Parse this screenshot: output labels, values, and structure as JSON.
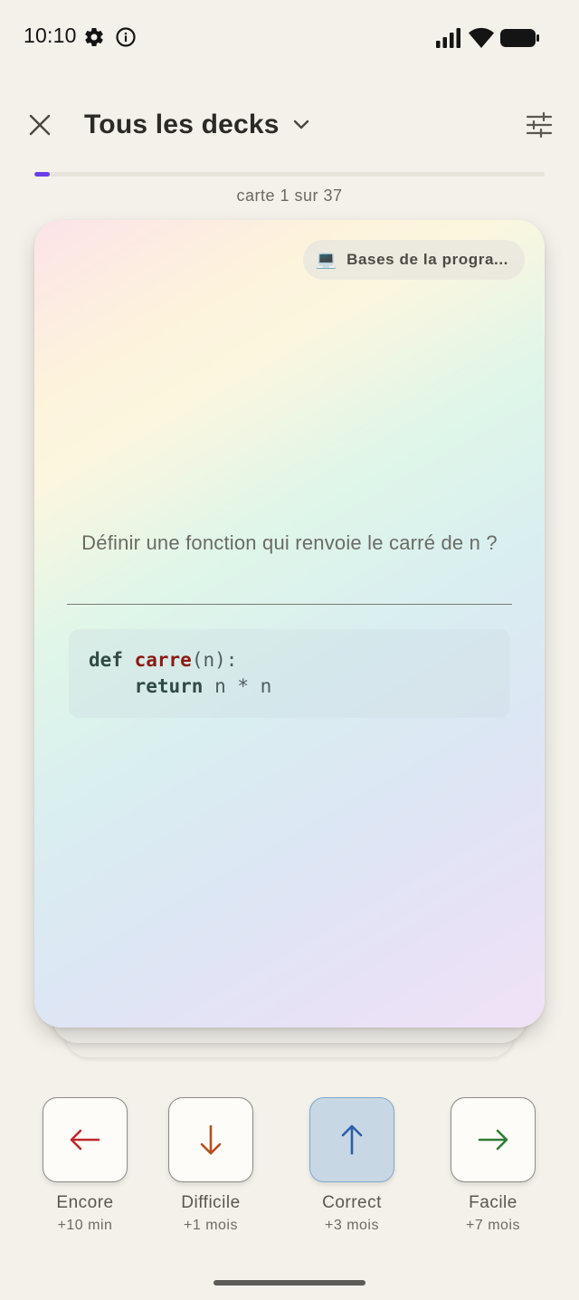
{
  "status_bar": {
    "time": "10:10",
    "left_icons": [
      "settings-gear-icon",
      "info-icon"
    ],
    "right_icons": [
      "signal-icon",
      "wifi-icon",
      "battery-icon"
    ]
  },
  "header": {
    "close_icon": "close-icon",
    "deck_title": "Tous les decks",
    "chevron_icon": "chevron-down-icon",
    "settings_icon": "sliders-icon"
  },
  "progress": {
    "text": "carte 1 sur 37",
    "current": 1,
    "total": 37,
    "color": "#6a3de8"
  },
  "card": {
    "deck_badge": {
      "emoji": "💻",
      "label": "Bases de la progra..."
    },
    "question": "Définir une fonction qui renvoie le carré de n ?",
    "code": {
      "line1": {
        "kw": "def",
        "fn": "carre",
        "rest": "(n):"
      },
      "line2": {
        "indent": "    ",
        "kw": "return",
        "rest": " n * n"
      }
    }
  },
  "answers": [
    {
      "label": "Encore",
      "interval": "+10 min",
      "icon": "arrow-left-icon",
      "color": "#c0282a",
      "selected": false
    },
    {
      "label": "Difficile",
      "interval": "+1 mois",
      "icon": "arrow-down-icon",
      "color": "#b2511f",
      "selected": false
    },
    {
      "label": "Correct",
      "interval": "+3 mois",
      "icon": "arrow-up-icon",
      "color": "#2a5fa8",
      "selected": true
    },
    {
      "label": "Facile",
      "interval": "+7 mois",
      "icon": "arrow-right-icon",
      "color": "#2f7d35",
      "selected": false
    }
  ]
}
